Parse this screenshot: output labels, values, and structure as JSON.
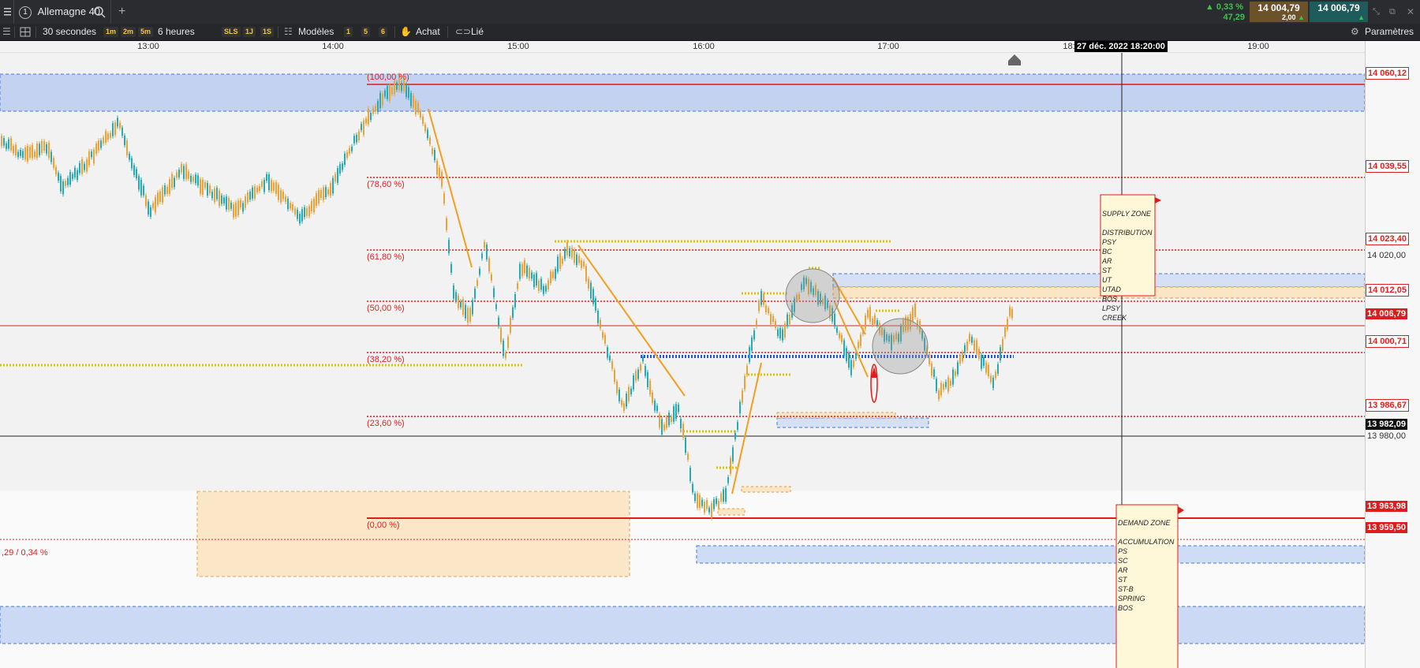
{
  "topbar": {
    "instrument_number": "1",
    "instrument": "Allemagne 40",
    "add_tab": "+",
    "change_pct": "0,33 %",
    "change_abs": "47,29",
    "bid": "14 004,79",
    "spread": "2,00",
    "ask": "14 006,79"
  },
  "toolbar": {
    "interval": "30 secondes",
    "quick_1m": "1m",
    "quick_2m": "2m",
    "quick_5m": "5m",
    "period": "6 heures",
    "sls": "SLS",
    "t1j": "1J",
    "t1s": "1S",
    "templates": "Modèles",
    "n1": "1",
    "n5": "5",
    "n6": "6",
    "buy": "Achat",
    "linked": "Lié",
    "settings": "Paramètres"
  },
  "time_axis": {
    "ticks": [
      "13:00",
      "14:00",
      "15:00",
      "16:00",
      "17:00",
      "18:",
      "19:00"
    ],
    "crosshair_date": "27 déc. 2022 18:20:00"
  },
  "fib_labels": [
    "(100,00 %)",
    "(78,60 %)",
    "(61,80 %)",
    "(50,00 %)",
    "(38,20 %)",
    "(23,60 %)",
    "(0,00 %)"
  ],
  "left_partial_label": ",29 / 0,34 %",
  "price_axis": {
    "red_labels": [
      "14 060,12",
      "14 039,55",
      "14 023,40",
      "14 012,05",
      "14 000,71",
      "13 986,67",
      "13 963,98",
      "13 959,50"
    ],
    "current_price": "14 006,79",
    "crosshair_price": "13 982,09",
    "scale_labels": [
      "14 020,00",
      "14 000,00",
      "13 980,00"
    ]
  },
  "supply_zone": {
    "title": "SUPPLY ZONE",
    "items": [
      "",
      "DISTRIBUTION",
      "PSY",
      "BC",
      "AR",
      "ST",
      "UT",
      "UTAD",
      "BOS",
      "LPSY",
      "CREEK"
    ]
  },
  "demand_zone": {
    "title": "DEMAND ZONE",
    "items": [
      "",
      "ACCUMULATION",
      "PS",
      "SC",
      "AR",
      "ST",
      "ST-B",
      "SPRING",
      "BOS"
    ]
  },
  "colors": {
    "fib_line": "#e01b1b",
    "zone_blue": "#c9d6f2",
    "zone_orange": "#fbe6c6",
    "candle_up": "#28a9b3",
    "candle_orange": "#e8a43a",
    "trendline": "#f0a020",
    "dotted_yellow": "#d8c400"
  }
}
